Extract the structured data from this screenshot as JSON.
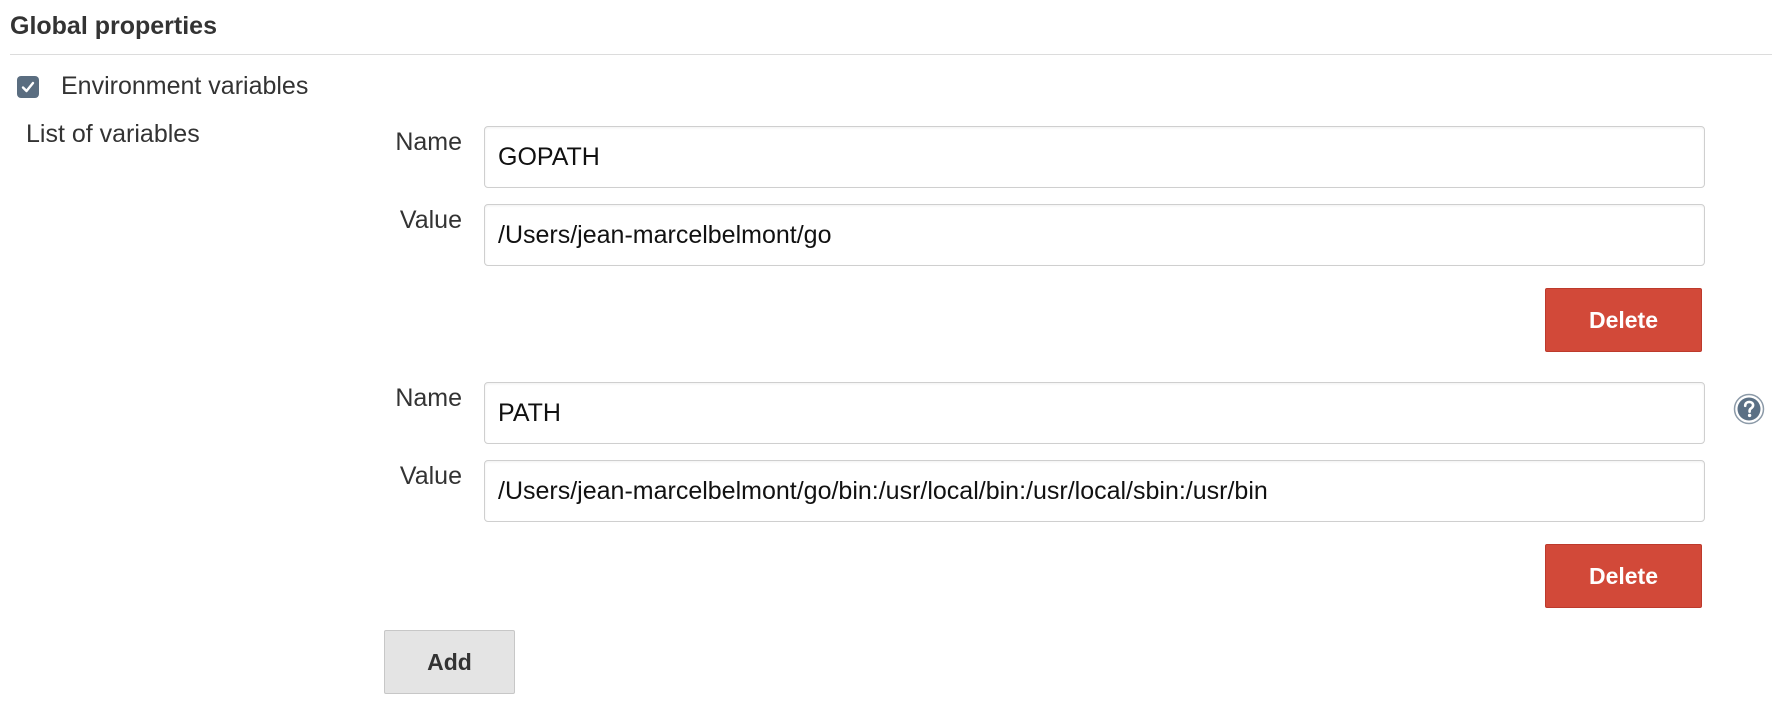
{
  "section": {
    "title": "Global properties"
  },
  "env_checkbox": {
    "checked": true,
    "label": "Environment variables"
  },
  "variables": {
    "list_label": "List of variables",
    "name_label": "Name",
    "value_label": "Value",
    "items": [
      {
        "name": "GOPATH",
        "value": "/Users/jean-marcelbelmont/go",
        "delete_label": "Delete"
      },
      {
        "name": "PATH",
        "value": "/Users/jean-marcelbelmont/go/bin:/usr/local/bin:/usr/local/sbin:/usr/bin",
        "delete_label": "Delete"
      }
    ],
    "add_label": "Add"
  },
  "icons": {
    "checkbox": "checkmark-icon",
    "help": "help-icon"
  },
  "colors": {
    "delete_button": "#d24939",
    "add_button": "#e4e4e4",
    "checkbox": "#5a6d80",
    "help_icon": "#5b7085"
  }
}
